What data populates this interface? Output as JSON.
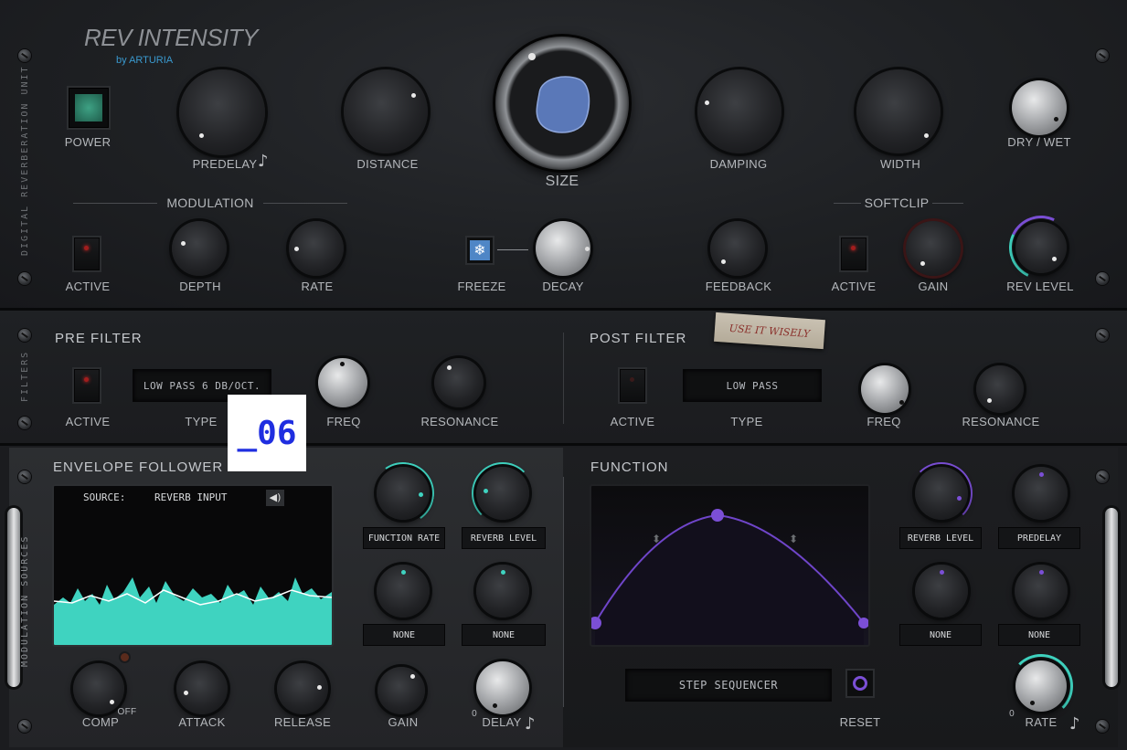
{
  "app": {
    "title": "REV INTENSITY",
    "subtitle": "by ARTURIA",
    "side_label_top": "DIGITAL REVERBERATION UNIT",
    "side_label_filters": "FILTERS",
    "side_label_mod": "MODULATION SOURCES"
  },
  "colors": {
    "accent_teal": "#3fd3c0",
    "accent_purple": "#7b4fd6",
    "led_red": "#ff2b2b",
    "power_green": "#2f8a6c"
  },
  "top": {
    "power": "POWER",
    "knobs": {
      "predelay": "PREDELAY",
      "distance": "DISTANCE",
      "size": "SIZE",
      "damping": "DAMPING",
      "width": "WIDTH",
      "drywet": "DRY / WET"
    },
    "modulation": {
      "title": "MODULATION",
      "active": "ACTIVE",
      "depth": "DEPTH",
      "rate": "RATE"
    },
    "freeze": "FREEZE",
    "decay": "DECAY",
    "feedback": "FEEDBACK",
    "softclip": {
      "title": "SOFTCLIP",
      "active": "ACTIVE",
      "gain": "GAIN"
    },
    "rev_level": "REV LEVEL"
  },
  "filters": {
    "pre": {
      "title": "PRE FILTER",
      "active": "ACTIVE",
      "type_value": "LOW PASS 6 DB/OCT.",
      "type": "TYPE",
      "freq": "FREQ",
      "resonance": "RESONANCE"
    },
    "post": {
      "title": "POST FILTER",
      "active": "ACTIVE",
      "type_value": "LOW PASS",
      "type": "TYPE",
      "freq": "FREQ",
      "resonance": "RESONANCE"
    },
    "sticker": "USE IT WISELY"
  },
  "envelope": {
    "title": "ENVELOPE FOLLOWER",
    "source_label": "SOURCE:",
    "source_value": "REVERB INPUT",
    "dest1": "FUNCTION RATE",
    "dest2": "REVERB LEVEL",
    "dest3": "NONE",
    "dest4": "NONE",
    "comp": "COMP",
    "off": "OFF",
    "attack": "ATTACK",
    "release": "RELEASE",
    "gain": "GAIN",
    "delay": "DELAY",
    "zero": "0"
  },
  "function": {
    "title": "FUNCTION",
    "dest1": "REVERB LEVEL",
    "dest2": "PREDELAY",
    "dest3": "NONE",
    "dest4": "NONE",
    "mode": "STEP SEQUENCER",
    "reset": "RESET",
    "rate": "RATE",
    "zero": "0"
  },
  "overlay": {
    "text": "_06"
  }
}
